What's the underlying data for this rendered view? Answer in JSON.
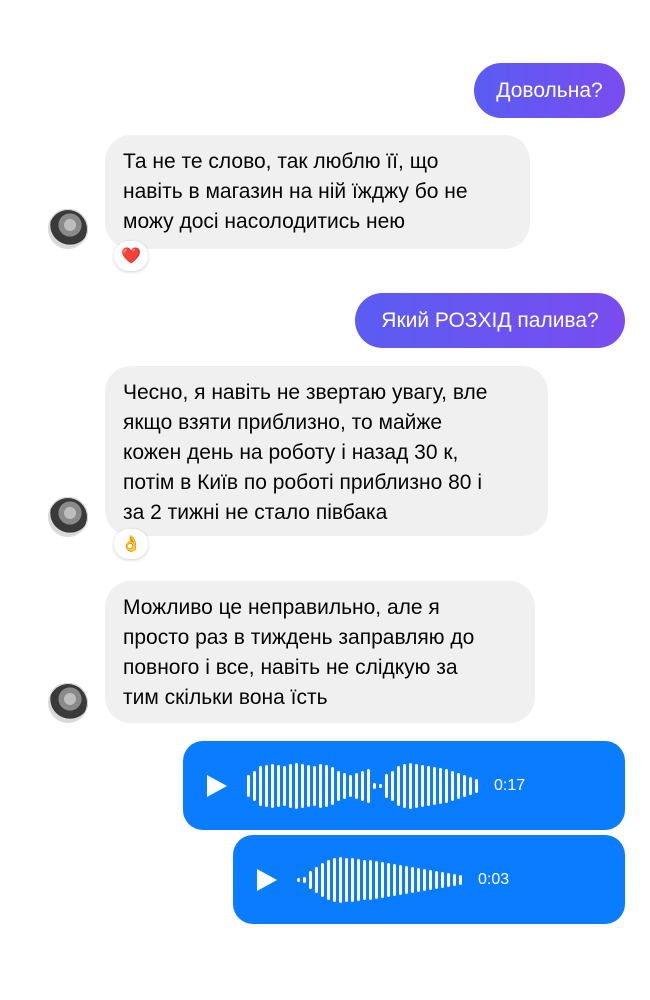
{
  "messages": [
    {
      "type": "outgoing_text",
      "text": "Довольна?"
    },
    {
      "type": "incoming_text",
      "lines": [
        "Та не те слово, так люблю її, що",
        "навіть в магазин на ній їжджу бо не",
        "можу досі насолодитись нею"
      ],
      "reaction": "❤️"
    },
    {
      "type": "outgoing_text",
      "text": "Який РОЗХІД палива?"
    },
    {
      "type": "incoming_text",
      "lines": [
        "Чесно, я навіть не звертаю увагу, вле",
        "якщо взяти приблизно, то майже",
        "кожен день на роботу і назад 30 к,",
        "потім в Київ по роботі приблизно 80 і",
        "за 2 тижні не стало півбака"
      ],
      "reaction": "👌"
    },
    {
      "type": "incoming_text",
      "lines": [
        "Можливо це неправильно, але я",
        "просто раз в тиждень заправляю до",
        "повного і все, навіть не слідкую за",
        "тим скільки вона їсть"
      ]
    },
    {
      "type": "voice",
      "duration": "0:17",
      "icon": "play-icon"
    },
    {
      "type": "voice",
      "duration": "0:03",
      "icon": "play-icon"
    }
  ],
  "colors": {
    "outgoing_gradient_start": "#5a5cf3",
    "outgoing_gradient_end": "#7a4cf0",
    "voice_bubble": "#0a7cff",
    "incoming_bubble": "#f0f0f0"
  }
}
